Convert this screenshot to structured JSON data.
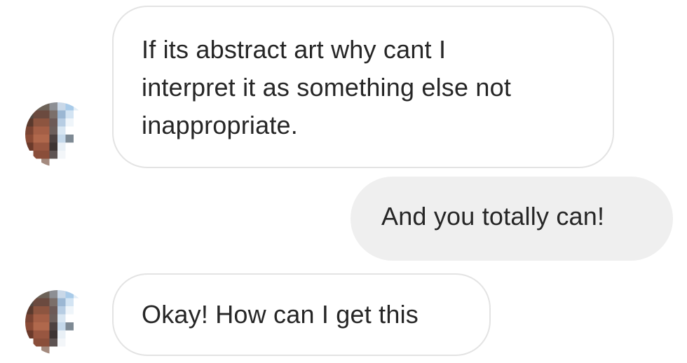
{
  "messages": [
    {
      "sender": "other",
      "lines": [
        "If its abstract art why cant I",
        "interpret it as something else not",
        "inappropriate."
      ]
    },
    {
      "sender": "me",
      "lines": [
        "And you totally can!"
      ]
    },
    {
      "sender": "other",
      "lines": [
        "Okay! How can I get this"
      ]
    }
  ],
  "colors": {
    "incoming_bubble_border": "#e3e3e3",
    "outgoing_bubble_bg": "#efefef",
    "text": "#262626"
  },
  "icons": {
    "avatar": "pixelated-avatar-icon"
  }
}
